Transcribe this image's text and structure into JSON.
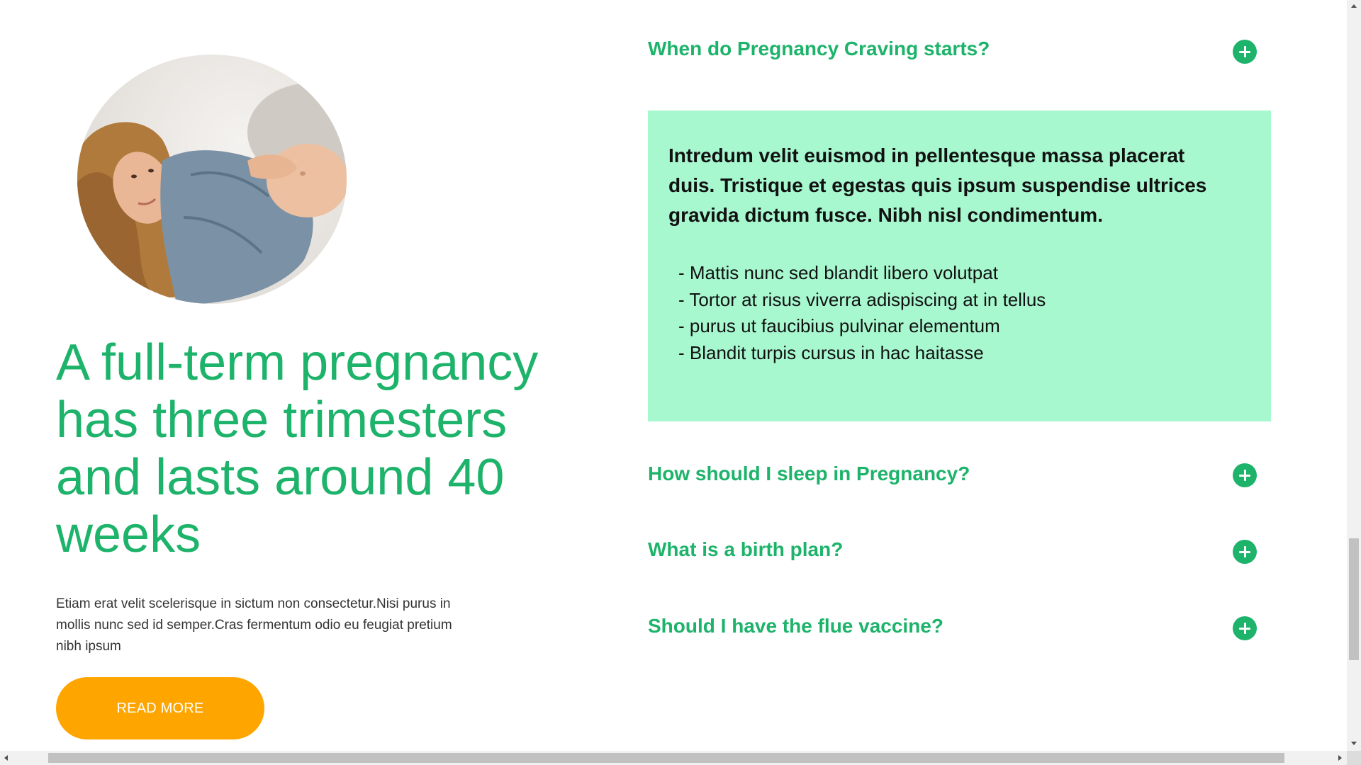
{
  "hero": {
    "image_alt": "pregnant woman lying down",
    "title": "A full-term pregnancy has three trimesters and lasts around 40 weeks",
    "body": "Etiam erat velit scelerisque in sictum non consectetur.Nisi purus in mollis nunc sed id semper.Cras fermentum odio eu feugiat pretium nibh ipsum",
    "button_label": "READ MORE"
  },
  "faq": {
    "accent_color": "#1db36a",
    "panel_color": "#a7f7cf",
    "items": [
      {
        "question": "When do Pregnancy Craving starts?",
        "icon": "plus-circle-icon",
        "expanded": true
      },
      {
        "question": "How should I sleep in Pregnancy?",
        "icon": "plus-circle-icon",
        "expanded": false
      },
      {
        "question": "What is a birth plan?",
        "icon": "plus-circle-icon",
        "expanded": false
      },
      {
        "question": "Should I have the flue vaccine?",
        "icon": "plus-circle-icon",
        "expanded": false
      }
    ],
    "answer": {
      "lead": "Intredum velit euismod in pellentesque massa placerat duis. Tristique et egestas quis ipsum suspendise ultrices gravida dictum fusce. Nibh nisl condimentum.",
      "bullets": [
        "- Mattis nunc sed blandit libero volutpat",
        "- Tortor at risus viverra adispiscing at in tellus",
        "- purus ut faucibius pulvinar elementum",
        "- Blandit turpis cursus in hac haitasse"
      ]
    }
  },
  "colors": {
    "button": "#ffa500",
    "heading": "#1db36a"
  }
}
